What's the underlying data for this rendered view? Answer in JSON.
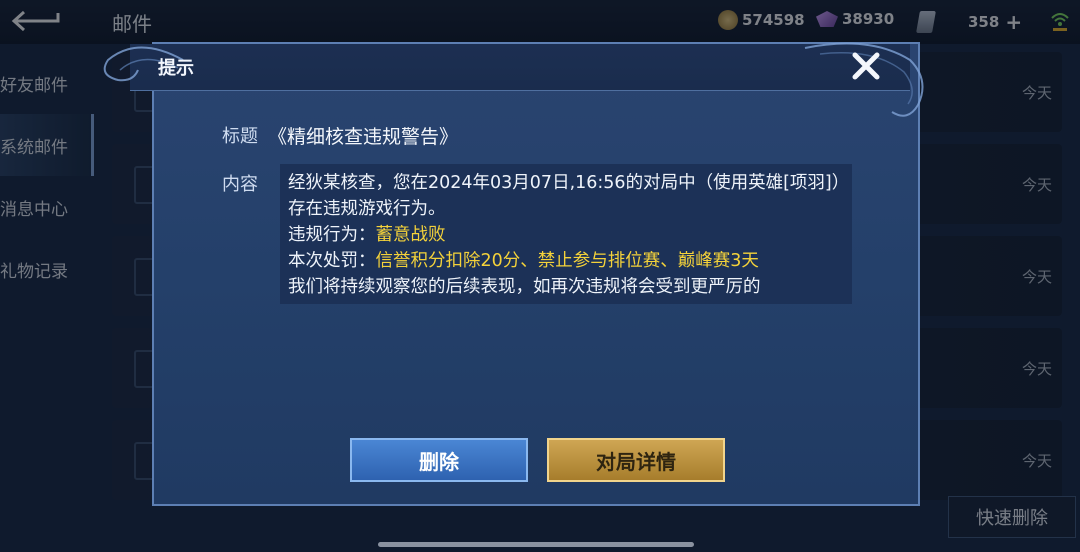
{
  "topbar": {
    "title": "邮件",
    "coins": "574598",
    "gems": "38930",
    "vouchers": "358"
  },
  "sidebar": {
    "items": [
      {
        "label": "好友邮件"
      },
      {
        "label": "系统邮件"
      },
      {
        "label": "消息中心"
      },
      {
        "label": "礼物记录"
      }
    ]
  },
  "mail_list": {
    "dates": [
      "今天",
      "今天",
      "今天",
      "今天",
      "今天"
    ],
    "quick_delete": "快速删除"
  },
  "dialog": {
    "header": "提示",
    "title_label": "标题",
    "title": "《精细核查违规警告》",
    "content_label": "内容",
    "content": {
      "line1": "经狄某核查，您在2024年03月07日,16:56的对局中（使用英雄[项羽]）存在违规游戏行为。",
      "violation_prefix": "违规行为：",
      "violation": "蓄意战败",
      "penalty_prefix": "本次处罚：",
      "penalty": "信誉积分扣除20分、禁止参与排位赛、巅峰赛3天",
      "line4": "我们将持续观察您的后续表现，如再次违规将会受到更严厉的"
    },
    "delete_button": "删除",
    "details_button": "对局详情"
  },
  "colors": {
    "highlight": "#f4d23a",
    "dialog_bg": "#24406a",
    "delete_btn": "#3a72c2",
    "details_btn": "#c39a48"
  }
}
